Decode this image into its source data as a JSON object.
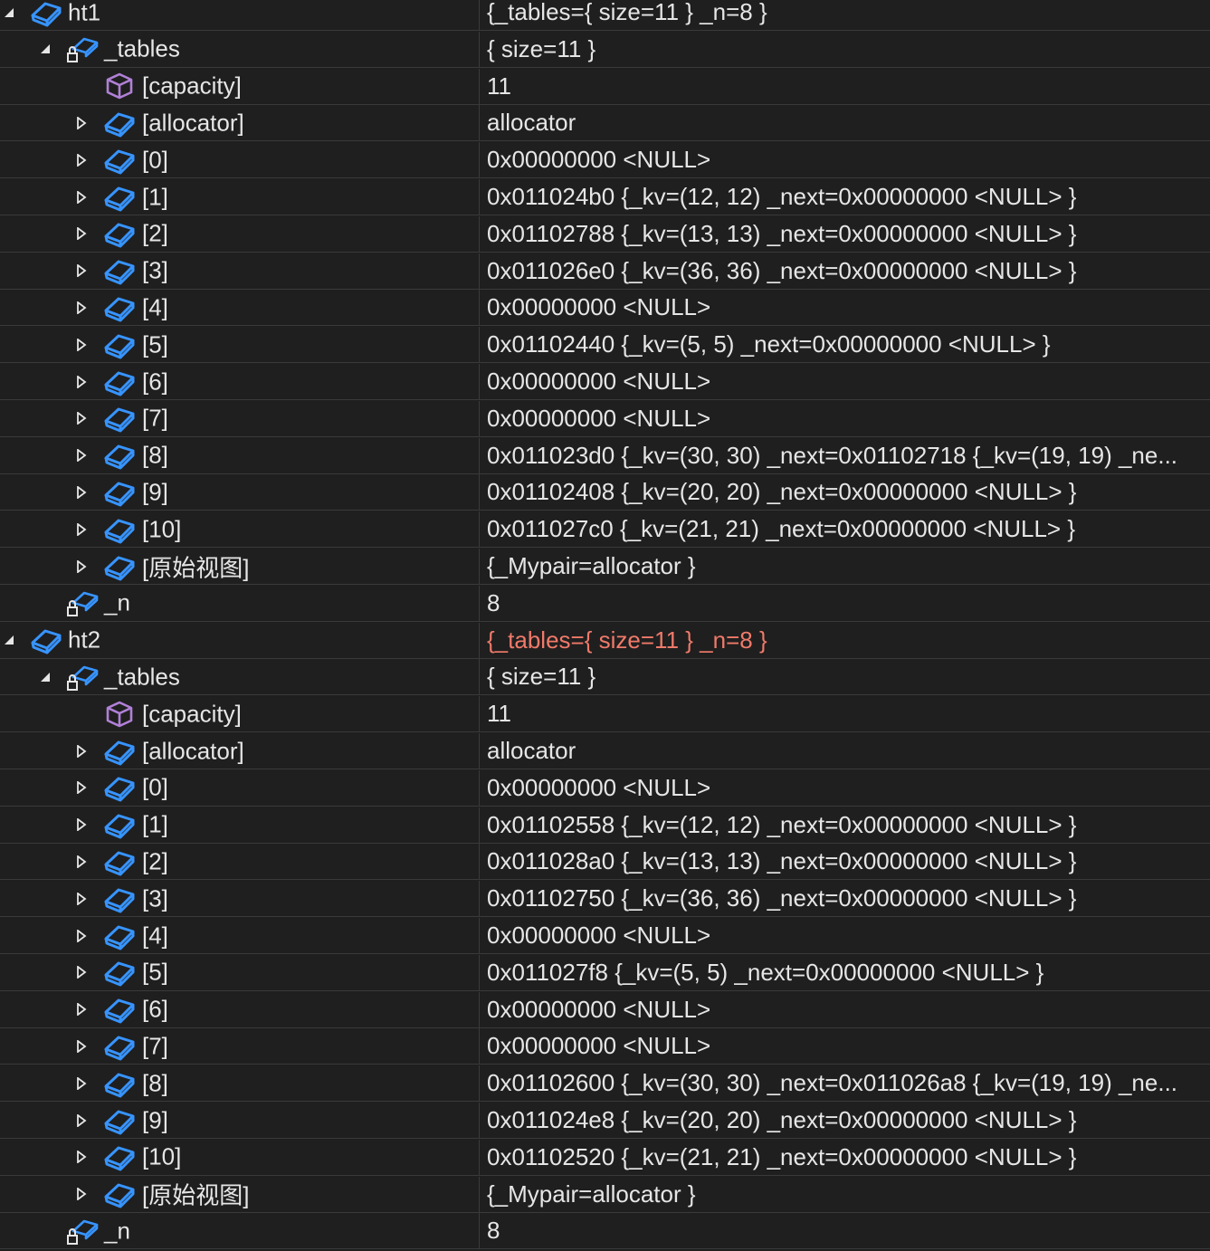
{
  "rows": [
    {
      "depth": 0,
      "expander": "expanded",
      "icon": "object",
      "name": "ht1",
      "value": "{_tables={ size=11 } _n=8 }",
      "changed": false
    },
    {
      "depth": 1,
      "expander": "expanded",
      "icon": "private-field",
      "name": "_tables",
      "value": "{ size=11 }",
      "changed": false
    },
    {
      "depth": 2,
      "expander": "none",
      "icon": "property",
      "name": "[capacity]",
      "value": "11",
      "changed": false
    },
    {
      "depth": 2,
      "expander": "collapsed",
      "icon": "object",
      "name": "[allocator]",
      "value": "allocator",
      "changed": false
    },
    {
      "depth": 2,
      "expander": "collapsed",
      "icon": "object",
      "name": "[0]",
      "value": "0x00000000 <NULL>",
      "changed": false
    },
    {
      "depth": 2,
      "expander": "collapsed",
      "icon": "object",
      "name": "[1]",
      "value": "0x011024b0 {_kv=(12, 12) _next=0x00000000 <NULL> }",
      "changed": false
    },
    {
      "depth": 2,
      "expander": "collapsed",
      "icon": "object",
      "name": "[2]",
      "value": "0x01102788 {_kv=(13, 13) _next=0x00000000 <NULL> }",
      "changed": false
    },
    {
      "depth": 2,
      "expander": "collapsed",
      "icon": "object",
      "name": "[3]",
      "value": "0x011026e0 {_kv=(36, 36) _next=0x00000000 <NULL> }",
      "changed": false
    },
    {
      "depth": 2,
      "expander": "collapsed",
      "icon": "object",
      "name": "[4]",
      "value": "0x00000000 <NULL>",
      "changed": false
    },
    {
      "depth": 2,
      "expander": "collapsed",
      "icon": "object",
      "name": "[5]",
      "value": "0x01102440 {_kv=(5, 5) _next=0x00000000 <NULL> }",
      "changed": false
    },
    {
      "depth": 2,
      "expander": "collapsed",
      "icon": "object",
      "name": "[6]",
      "value": "0x00000000 <NULL>",
      "changed": false
    },
    {
      "depth": 2,
      "expander": "collapsed",
      "icon": "object",
      "name": "[7]",
      "value": "0x00000000 <NULL>",
      "changed": false
    },
    {
      "depth": 2,
      "expander": "collapsed",
      "icon": "object",
      "name": "[8]",
      "value": "0x011023d0 {_kv=(30, 30) _next=0x01102718 {_kv=(19, 19) _ne...",
      "changed": false
    },
    {
      "depth": 2,
      "expander": "collapsed",
      "icon": "object",
      "name": "[9]",
      "value": "0x01102408 {_kv=(20, 20) _next=0x00000000 <NULL> }",
      "changed": false
    },
    {
      "depth": 2,
      "expander": "collapsed",
      "icon": "object",
      "name": "[10]",
      "value": "0x011027c0 {_kv=(21, 21) _next=0x00000000 <NULL> }",
      "changed": false
    },
    {
      "depth": 2,
      "expander": "collapsed",
      "icon": "object",
      "name": "[原始视图]",
      "value": "{_Mypair=allocator }",
      "changed": false
    },
    {
      "depth": 1,
      "expander": "none",
      "icon": "private-field",
      "name": "_n",
      "value": "8",
      "changed": false
    },
    {
      "depth": 0,
      "expander": "expanded",
      "icon": "object",
      "name": "ht2",
      "value": "{_tables={ size=11 } _n=8 }",
      "changed": true
    },
    {
      "depth": 1,
      "expander": "expanded",
      "icon": "private-field",
      "name": "_tables",
      "value": "{ size=11 }",
      "changed": false
    },
    {
      "depth": 2,
      "expander": "none",
      "icon": "property",
      "name": "[capacity]",
      "value": "11",
      "changed": false
    },
    {
      "depth": 2,
      "expander": "collapsed",
      "icon": "object",
      "name": "[allocator]",
      "value": "allocator",
      "changed": false
    },
    {
      "depth": 2,
      "expander": "collapsed",
      "icon": "object",
      "name": "[0]",
      "value": "0x00000000 <NULL>",
      "changed": false
    },
    {
      "depth": 2,
      "expander": "collapsed",
      "icon": "object",
      "name": "[1]",
      "value": "0x01102558 {_kv=(12, 12) _next=0x00000000 <NULL> }",
      "changed": false
    },
    {
      "depth": 2,
      "expander": "collapsed",
      "icon": "object",
      "name": "[2]",
      "value": "0x011028a0 {_kv=(13, 13) _next=0x00000000 <NULL> }",
      "changed": false
    },
    {
      "depth": 2,
      "expander": "collapsed",
      "icon": "object",
      "name": "[3]",
      "value": "0x01102750 {_kv=(36, 36) _next=0x00000000 <NULL> }",
      "changed": false
    },
    {
      "depth": 2,
      "expander": "collapsed",
      "icon": "object",
      "name": "[4]",
      "value": "0x00000000 <NULL>",
      "changed": false
    },
    {
      "depth": 2,
      "expander": "collapsed",
      "icon": "object",
      "name": "[5]",
      "value": "0x011027f8 {_kv=(5, 5) _next=0x00000000 <NULL> }",
      "changed": false
    },
    {
      "depth": 2,
      "expander": "collapsed",
      "icon": "object",
      "name": "[6]",
      "value": "0x00000000 <NULL>",
      "changed": false
    },
    {
      "depth": 2,
      "expander": "collapsed",
      "icon": "object",
      "name": "[7]",
      "value": "0x00000000 <NULL>",
      "changed": false
    },
    {
      "depth": 2,
      "expander": "collapsed",
      "icon": "object",
      "name": "[8]",
      "value": "0x01102600 {_kv=(30, 30) _next=0x011026a8 {_kv=(19, 19) _ne...",
      "changed": false
    },
    {
      "depth": 2,
      "expander": "collapsed",
      "icon": "object",
      "name": "[9]",
      "value": "0x011024e8 {_kv=(20, 20) _next=0x00000000 <NULL> }",
      "changed": false
    },
    {
      "depth": 2,
      "expander": "collapsed",
      "icon": "object",
      "name": "[10]",
      "value": "0x01102520 {_kv=(21, 21) _next=0x00000000 <NULL> }",
      "changed": false
    },
    {
      "depth": 2,
      "expander": "collapsed",
      "icon": "object",
      "name": "[原始视图]",
      "value": "{_Mypair=allocator }",
      "changed": false
    },
    {
      "depth": 1,
      "expander": "none",
      "icon": "private-field",
      "name": "_n",
      "value": "8",
      "changed": false
    }
  ],
  "colors": {
    "background": "#1f1f1f",
    "text": "#e6e6e6",
    "changed_value": "#f07a6a",
    "object_icon": "#3794ff",
    "property_icon": "#b180d7",
    "grid_line": "#3a3a3a"
  }
}
